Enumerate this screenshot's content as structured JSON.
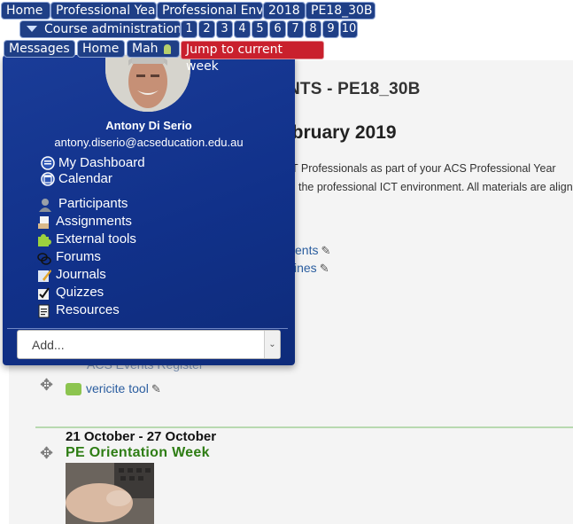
{
  "breadcrumb": {
    "items": [
      {
        "label": "Home"
      },
      {
        "label": "Professional Year"
      },
      {
        "label": "Professional Environment"
      },
      {
        "label": "2018"
      },
      {
        "label": "PE18_30B"
      }
    ]
  },
  "course_admin": {
    "label": "Course administration"
  },
  "weeks": [
    "1",
    "2",
    "3",
    "4",
    "5",
    "6",
    "7",
    "8",
    "9",
    "10"
  ],
  "subnav": {
    "messages": "Messages",
    "home": "Home",
    "mah": "Mah"
  },
  "jump": {
    "label": "Jump to current week"
  },
  "background": {
    "course_heading": "NTS - PE18_30B",
    "date_heading": "ebruary 2019",
    "line1": "CT Professionals as part of your ACS Professional Year",
    "line2": "the professional ICT environment. All materials are align",
    "act1": "ents",
    "act2": "ines",
    "act3": "ACS Events Register",
    "act4": "vericite tool",
    "week_date": "21 October - 27 October",
    "week_title": "PE Orientation Week"
  },
  "user": {
    "name": "Antony Di Serio",
    "email": "antony.diserio@acseducation.edu.au"
  },
  "menu": {
    "dashboard": "My Dashboard",
    "calendar": "Calendar",
    "participants": "Participants",
    "assignments": "Assignments",
    "external_tools": "External tools",
    "forums": "Forums",
    "journals": "Journals",
    "quizzes": "Quizzes",
    "resources": "Resources"
  },
  "add_select": {
    "value": "Add..."
  },
  "colors": {
    "nav": "#1f3f86",
    "jump": "#c9202d",
    "panel": "#13348c",
    "week_title": "#2e7d14"
  }
}
